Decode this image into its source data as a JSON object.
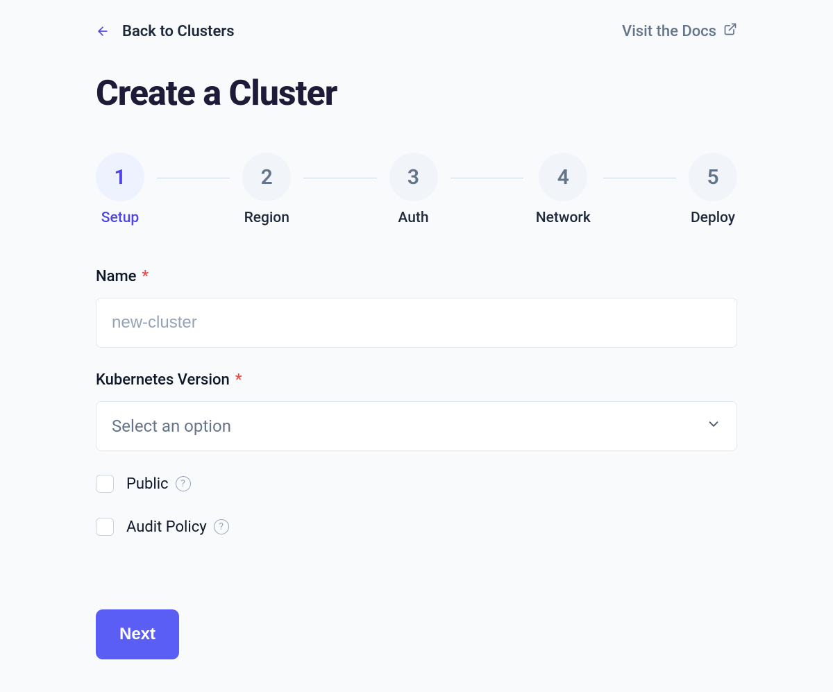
{
  "header": {
    "back_label": "Back to Clusters",
    "docs_label": "Visit the Docs"
  },
  "page_title": "Create a Cluster",
  "stepper": [
    {
      "num": "1",
      "label": "Setup",
      "active": true
    },
    {
      "num": "2",
      "label": "Region",
      "active": false
    },
    {
      "num": "3",
      "label": "Auth",
      "active": false
    },
    {
      "num": "4",
      "label": "Network",
      "active": false
    },
    {
      "num": "5",
      "label": "Deploy",
      "active": false
    }
  ],
  "form": {
    "name_label": "Name",
    "name_placeholder": "new-cluster",
    "name_value": "",
    "version_label": "Kubernetes Version",
    "version_placeholder": "Select an option",
    "public_label": "Public",
    "audit_label": "Audit Policy",
    "required_marker": "*"
  },
  "actions": {
    "next_label": "Next"
  }
}
